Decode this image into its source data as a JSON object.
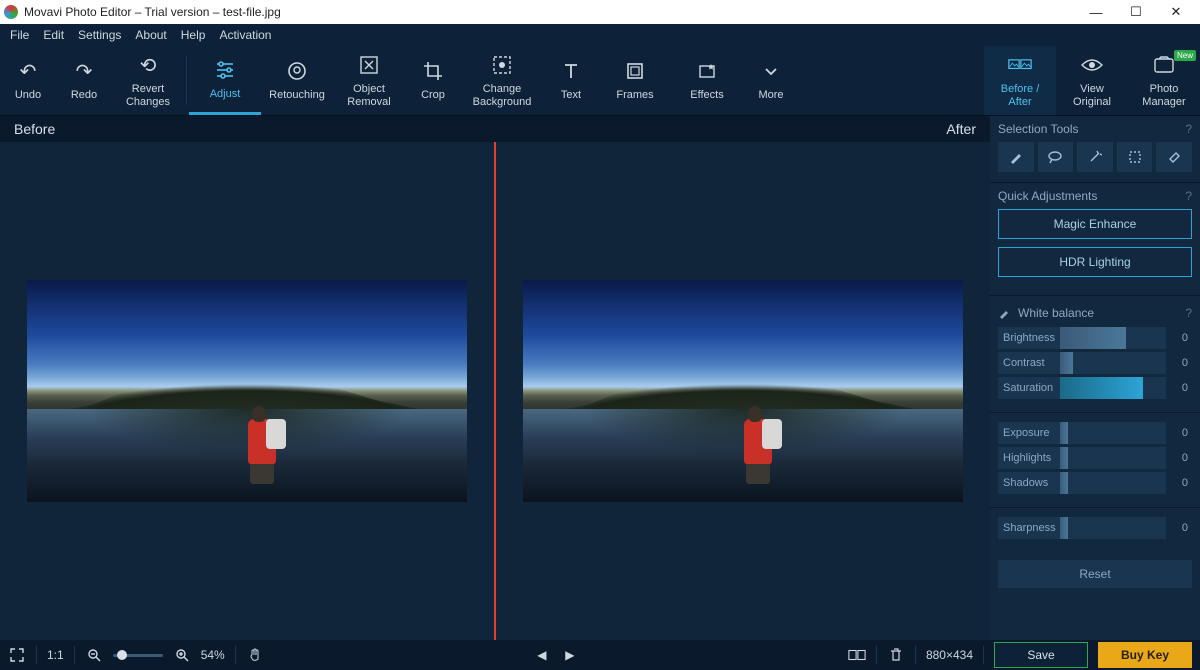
{
  "title": "Movavi Photo Editor – Trial version – test-file.jpg",
  "menu": [
    "File",
    "Edit",
    "Settings",
    "About",
    "Help",
    "Activation"
  ],
  "toolbar": {
    "undo": "Undo",
    "redo": "Redo",
    "revert": "Revert\nChanges",
    "adjust": "Adjust",
    "retouching": "Retouching",
    "object_removal": "Object\nRemoval",
    "crop": "Crop",
    "change_bg": "Change\nBackground",
    "text": "Text",
    "frames": "Frames",
    "effects": "Effects",
    "more": "More",
    "before_after": "Before /\nAfter",
    "view_original": "View\nOriginal",
    "photo_manager": "Photo\nManager",
    "new_badge": "New"
  },
  "compare": {
    "before": "Before",
    "after": "After"
  },
  "sidebar": {
    "selection_title": "Selection Tools",
    "quick_title": "Quick Adjustments",
    "magic_enhance": "Magic Enhance",
    "hdr_lighting": "HDR Lighting",
    "white_balance": "White balance",
    "sliders1": [
      {
        "label": "Brightness",
        "value": "0",
        "fill": 62
      },
      {
        "label": "Contrast",
        "value": "0",
        "fill": 12
      },
      {
        "label": "Saturation",
        "value": "0",
        "fill": 78,
        "accent": true
      }
    ],
    "sliders2": [
      {
        "label": "Exposure",
        "value": "0",
        "fill": 8
      },
      {
        "label": "Highlights",
        "value": "0",
        "fill": 8
      },
      {
        "label": "Shadows",
        "value": "0",
        "fill": 8
      }
    ],
    "sliders3": [
      {
        "label": "Sharpness",
        "value": "0",
        "fill": 8
      }
    ],
    "reset": "Reset"
  },
  "status": {
    "ratio": "1:1",
    "zoom": "54%",
    "dims": "880×434",
    "save": "Save",
    "buy": "Buy Key"
  }
}
